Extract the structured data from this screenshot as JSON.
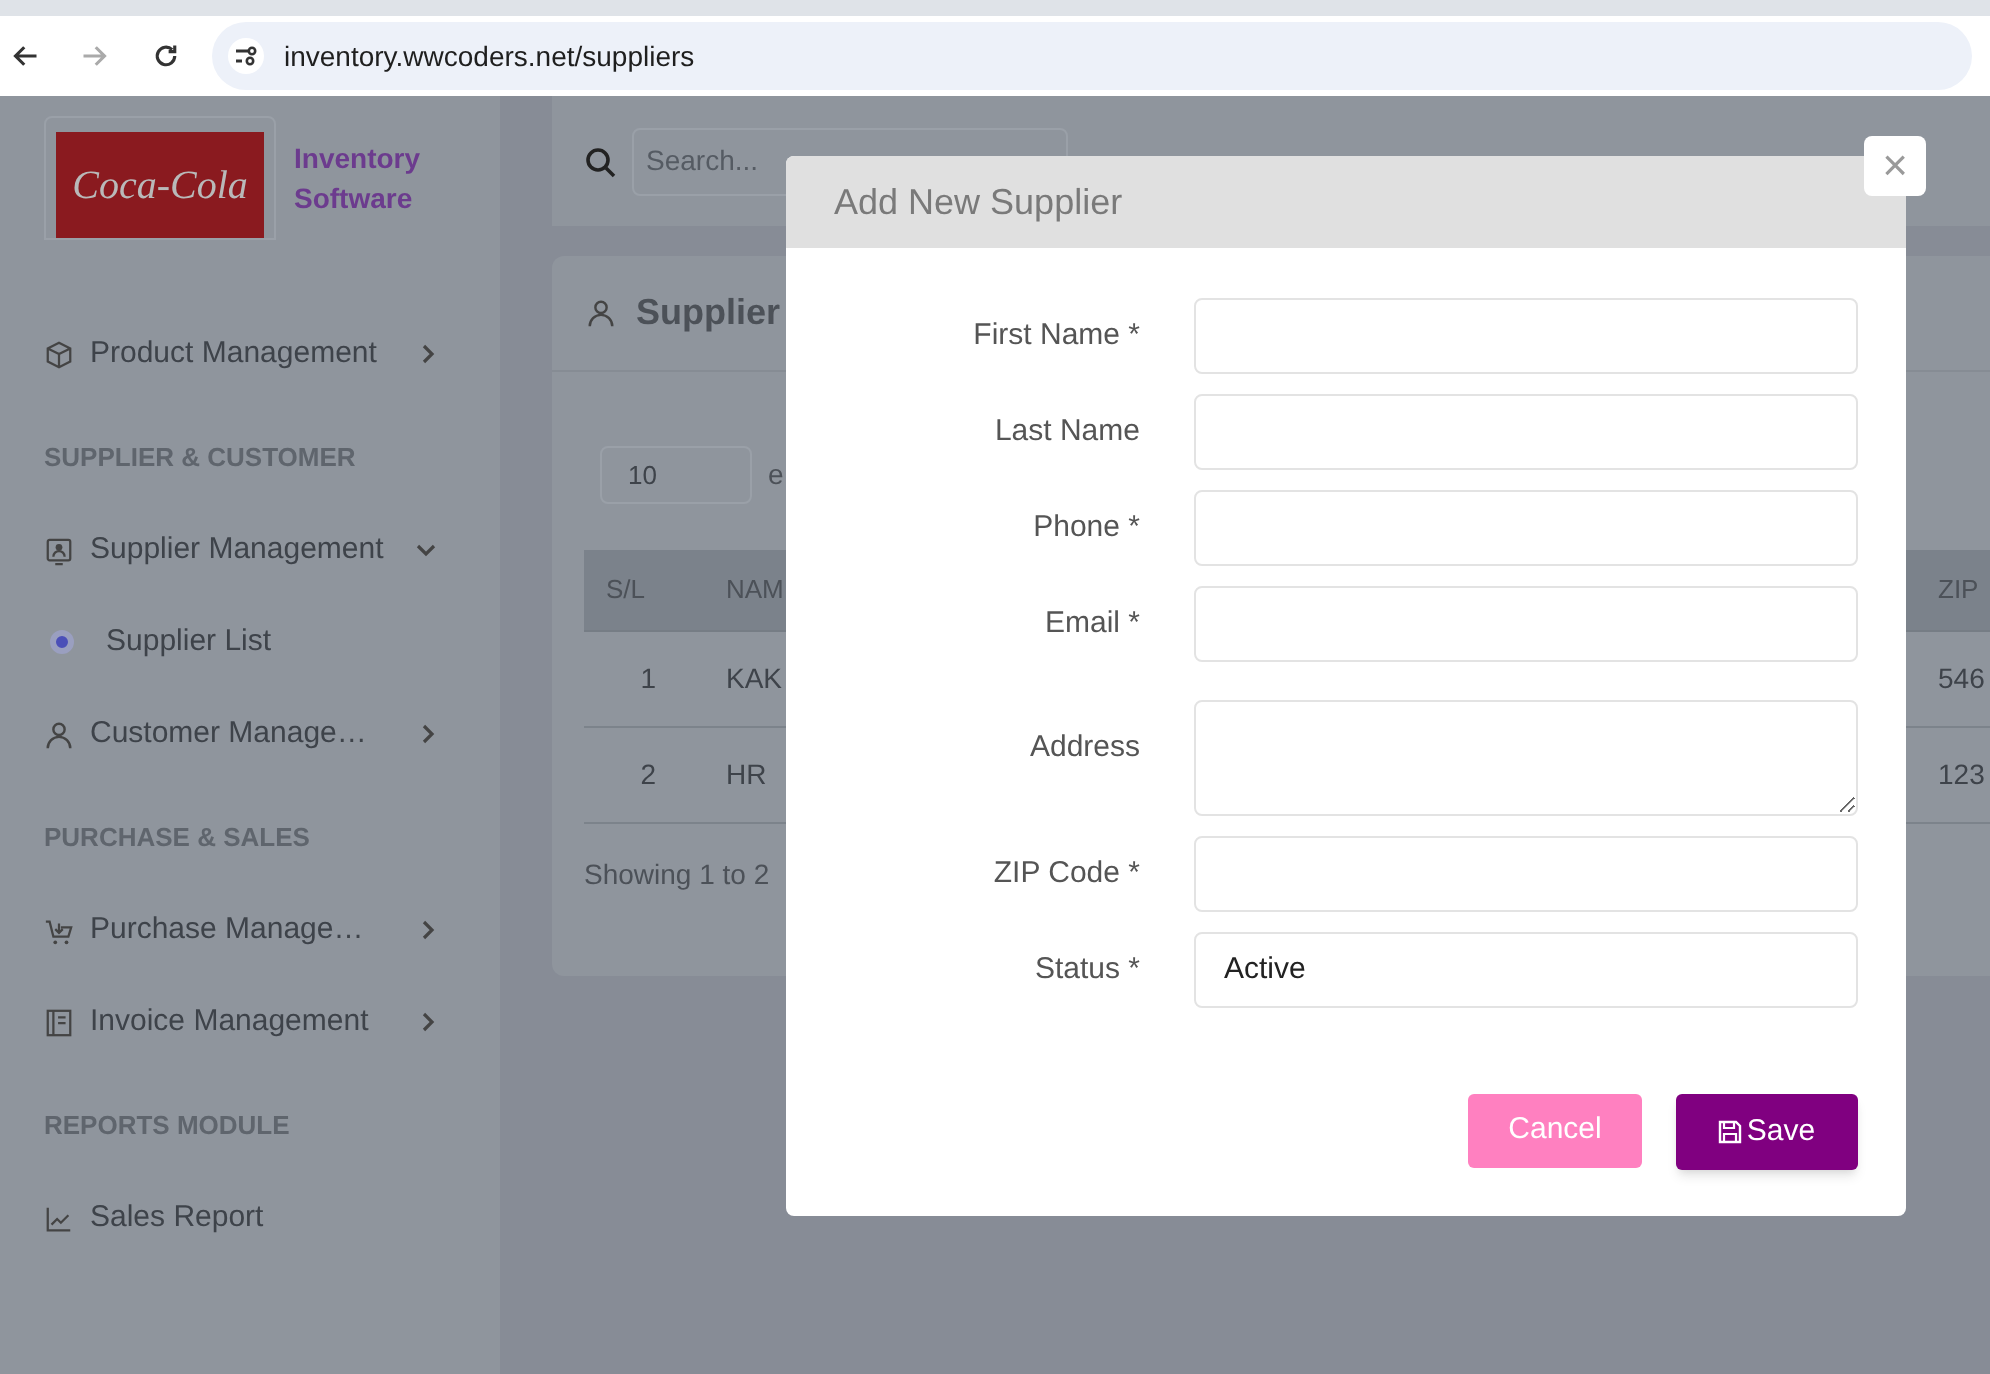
{
  "browser": {
    "url": "inventory.wwcoders.net/suppliers"
  },
  "sidebar": {
    "logo_text": "Coca-Cola",
    "brand": [
      "Inventory",
      "Software"
    ],
    "items": [
      {
        "kind": "item",
        "label": "Product Management",
        "expanded": false
      },
      {
        "kind": "section",
        "label": "SUPPLIER & CUSTOMER"
      },
      {
        "kind": "item",
        "label": "Supplier Management",
        "expanded": true
      },
      {
        "kind": "subitem",
        "label": "Supplier List",
        "selected": true
      },
      {
        "kind": "item",
        "label": "Customer Manage…",
        "expanded": false
      },
      {
        "kind": "section",
        "label": "PURCHASE & SALES"
      },
      {
        "kind": "item",
        "label": "Purchase Manage…",
        "expanded": false
      },
      {
        "kind": "item",
        "label": "Invoice Management",
        "expanded": false
      },
      {
        "kind": "section",
        "label": "REPORTS MODULE"
      },
      {
        "kind": "link",
        "label": "Sales Report"
      }
    ]
  },
  "topbar": {
    "search_placeholder": "Search..."
  },
  "card": {
    "title": "Supplier",
    "page_size": "10",
    "page_size_suffix": "e",
    "columns": [
      "S/L",
      "NAM",
      "ZIP"
    ],
    "rows": [
      [
        "1",
        "KAK",
        "546"
      ],
      [
        "2",
        "HR",
        "123"
      ]
    ],
    "footer": "Showing 1 to 2"
  },
  "modal": {
    "title": "Add New Supplier",
    "close": "×",
    "fields": [
      {
        "kind": "input",
        "label": "First Name *"
      },
      {
        "kind": "input",
        "label": "Last Name"
      },
      {
        "kind": "input",
        "label": "Phone *"
      },
      {
        "kind": "input",
        "label": "Email *"
      },
      {
        "kind": "textarea",
        "label": "Address"
      },
      {
        "kind": "input",
        "label": "ZIP Code *"
      },
      {
        "kind": "select",
        "label": "Status *",
        "value": "Active"
      }
    ],
    "buttons": [
      {
        "kind": "cancel",
        "label": "Cancel"
      },
      {
        "kind": "save",
        "label": "Save"
      }
    ]
  }
}
